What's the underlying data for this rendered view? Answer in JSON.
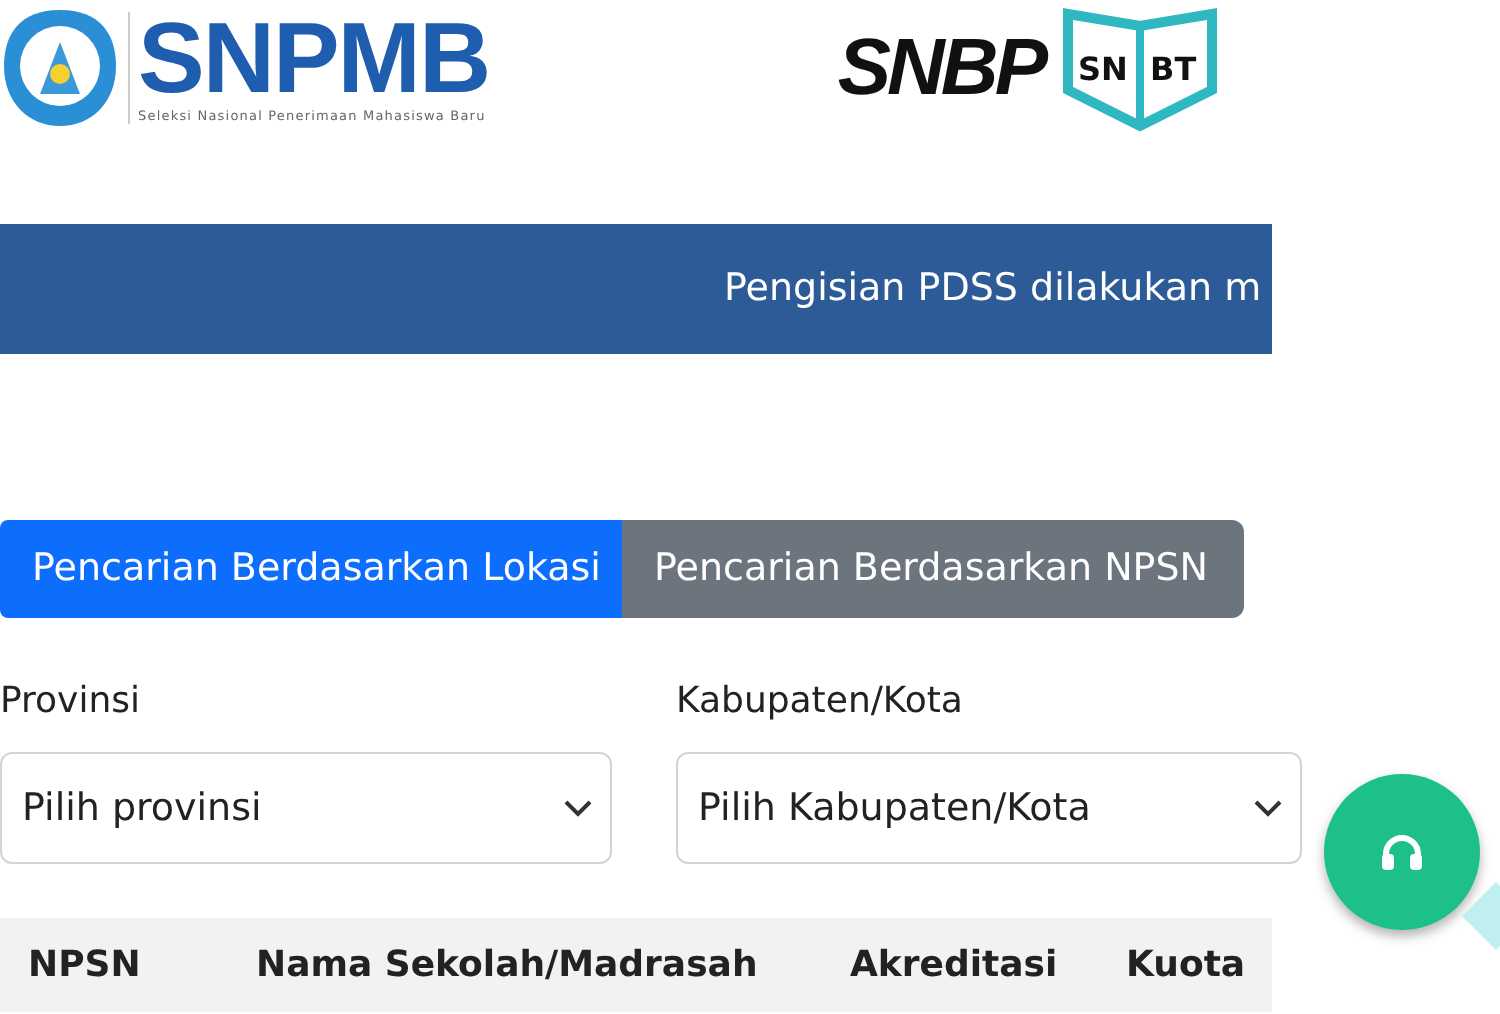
{
  "header": {
    "brand": "SNPMB",
    "tagline": "Seleksi Nasional Penerimaan Mahasiswa Baru",
    "logo_2": "SNBP",
    "logo_3": [
      "SN",
      "BT"
    ]
  },
  "announcement": "Pengisian PDSS dilakukan m",
  "tabs": [
    {
      "label": "Pencarian Berdasarkan Lokasi",
      "selected": true
    },
    {
      "label": "Pencarian Berdasarkan NPSN",
      "selected": false
    }
  ],
  "filters": [
    {
      "label": "Provinsi",
      "placeholder": "Pilih provinsi"
    },
    {
      "label": "Kabupaten/Kota",
      "placeholder": "Pilih Kabupaten/Kota"
    }
  ],
  "table": {
    "columns": [
      "NPSN",
      "Nama Sekolah/Madrasah",
      "Akreditasi",
      "Kuota"
    ]
  }
}
